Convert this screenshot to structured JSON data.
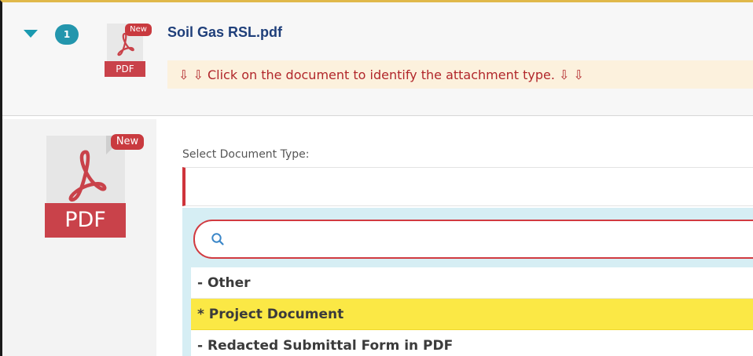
{
  "attachment": {
    "index": "1",
    "new_label": "New",
    "file_type_label": "PDF",
    "filename": "Soil Gas RSL.pdf",
    "hint": "⇩ ⇩ Click on the document to identify the attachment type. ⇩ ⇩"
  },
  "preview": {
    "new_label": "New",
    "file_type_label": "PDF"
  },
  "form": {
    "label": "Select Document Type:",
    "selected_value": ""
  },
  "dropdown": {
    "search_placeholder": "",
    "search_value": "",
    "options": [
      {
        "label": "- Other",
        "highlighted": false
      },
      {
        "label": "* Project Document",
        "highlighted": true
      },
      {
        "label": "- Redacted Submittal Form in PDF",
        "highlighted": false
      }
    ]
  },
  "colors": {
    "accent_teal": "#2396ad",
    "error_red": "#cf343b",
    "highlight_yellow": "#fbe845",
    "hint_background": "#fcf1dd",
    "dropdown_background": "#d6eef4",
    "filename_blue": "#1f3f7a"
  },
  "icons": {
    "expand": "chevron-down-icon",
    "file": "pdf-file-icon",
    "search": "search-icon"
  }
}
